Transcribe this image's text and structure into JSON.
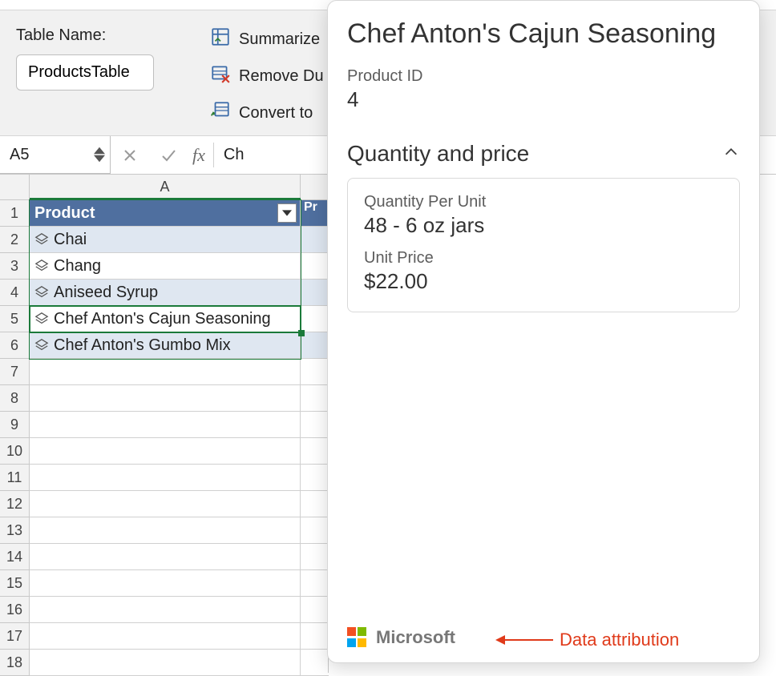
{
  "ribbon": {
    "table_name_label": "Table Name:",
    "table_name_value": "ProductsTable",
    "summarize_label": "Summarize",
    "remove_dup_label": "Remove Du",
    "convert_label": "Convert to"
  },
  "formula_bar": {
    "name_box": "A5",
    "fx_label": "fx",
    "formula_text": "Ch"
  },
  "grid": {
    "column_letter": "A",
    "header_a": "Product",
    "header_b": "Pr",
    "rows": [
      "Chai",
      "Chang",
      "Aniseed Syrup",
      "Chef Anton's Cajun Seasoning",
      "Chef Anton's Gumbo Mix"
    ],
    "max_row": 18
  },
  "card": {
    "title": "Chef Anton's Cajun Seasoning",
    "product_id_label": "Product ID",
    "product_id_value": "4",
    "section_title": "Quantity and price",
    "qpu_label": "Quantity Per Unit",
    "qpu_value": "48 - 6 oz jars",
    "unit_price_label": "Unit Price",
    "unit_price_value": "$22.00",
    "attribution": "Microsoft"
  },
  "annotation": "Data attribution"
}
